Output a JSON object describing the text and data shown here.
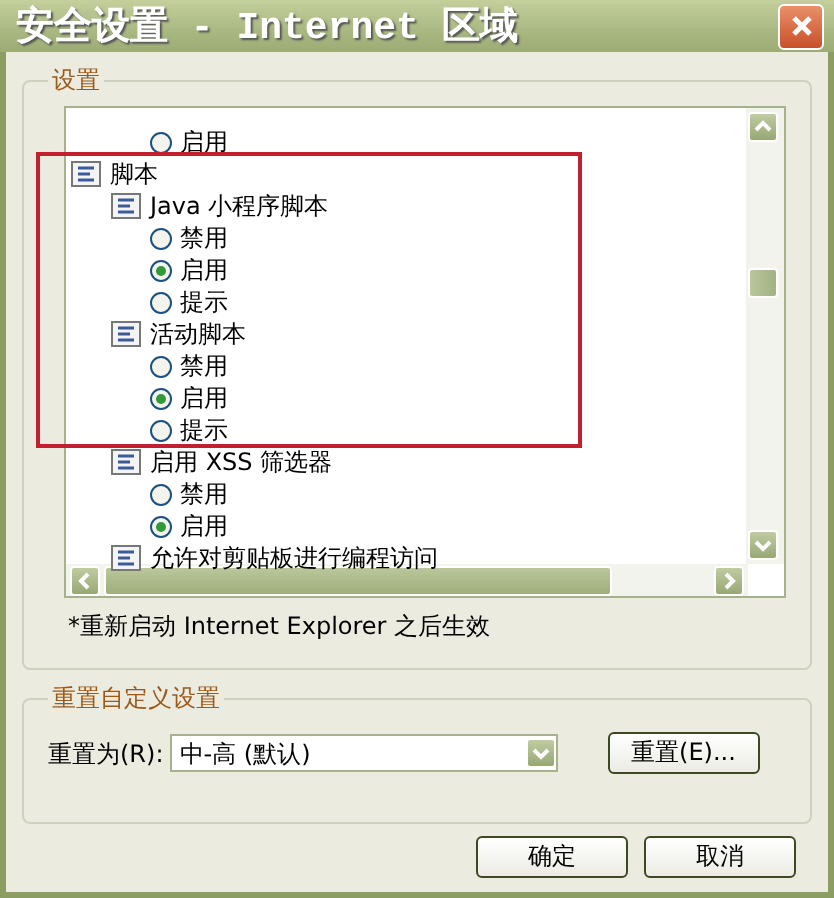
{
  "window": {
    "title": "安全设置 - Internet 区域"
  },
  "settings_group": {
    "legend": "设置",
    "tree": [
      {
        "kind": "radio",
        "label": "启用",
        "selected": false
      },
      {
        "kind": "category",
        "label": "脚本",
        "children": [
          {
            "kind": "setting",
            "label": "Java 小程序脚本",
            "children": [
              {
                "kind": "radio",
                "label": "禁用",
                "selected": false
              },
              {
                "kind": "radio",
                "label": "启用",
                "selected": true
              },
              {
                "kind": "radio",
                "label": "提示",
                "selected": false
              }
            ]
          },
          {
            "kind": "setting",
            "label": "活动脚本",
            "children": [
              {
                "kind": "radio",
                "label": "禁用",
                "selected": false
              },
              {
                "kind": "radio",
                "label": "启用",
                "selected": true
              },
              {
                "kind": "radio",
                "label": "提示",
                "selected": false
              }
            ]
          },
          {
            "kind": "setting",
            "label": "启用 XSS 筛选器",
            "children": [
              {
                "kind": "radio",
                "label": "禁用",
                "selected": false
              },
              {
                "kind": "radio",
                "label": "启用",
                "selected": true
              }
            ]
          },
          {
            "kind": "setting",
            "label": "允许对剪贴板进行编程访问"
          }
        ]
      }
    ],
    "note": "*重新启动 Internet Explorer 之后生效"
  },
  "reset_group": {
    "legend": "重置自定义设置",
    "label": "重置为(R):",
    "value": "中-高 (默认)",
    "button": "重置(E)..."
  },
  "buttons": [
    "确定",
    "取消"
  ]
}
